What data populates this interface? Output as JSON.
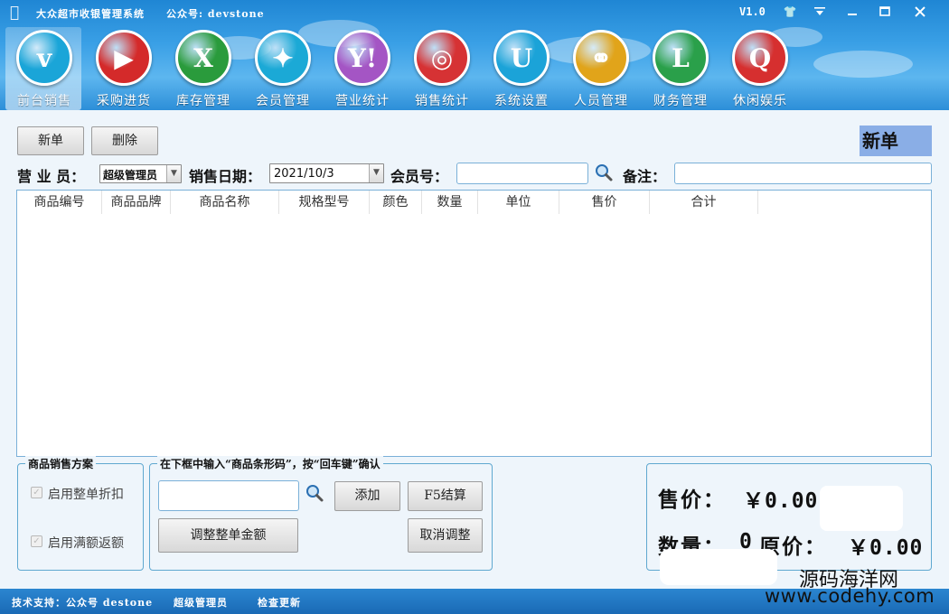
{
  "window": {
    "title": "大众超市收银管理系统",
    "account": "公众号: devstone",
    "version": "V1.0"
  },
  "nav": [
    {
      "label": "前台销售",
      "icon": "v-icon",
      "glyph": "v",
      "color": "#1aa5d8"
    },
    {
      "label": "采购进货",
      "icon": "youtube-icon",
      "glyph": "▶",
      "color": "#d42a2a"
    },
    {
      "label": "库存管理",
      "icon": "xing-icon",
      "glyph": "X",
      "color": "#2a9b3c"
    },
    {
      "label": "会员管理",
      "icon": "sparkle-icon",
      "glyph": "✦",
      "color": "#1ba9d6"
    },
    {
      "label": "营业统计",
      "icon": "yahoo-icon",
      "glyph": "Y!",
      "color": "#a455c4"
    },
    {
      "label": "销售统计",
      "icon": "weibo-icon",
      "glyph": "◎",
      "color": "#d63234"
    },
    {
      "label": "系统设置",
      "icon": "u-icon",
      "glyph": "U",
      "color": "#1ba3d8"
    },
    {
      "label": "人员管理",
      "icon": "chain-icon",
      "glyph": "⚭",
      "color": "#e1a41a"
    },
    {
      "label": "财务管理",
      "icon": "l-icon",
      "glyph": "L",
      "color": "#2aa04a"
    },
    {
      "label": "休闲娱乐",
      "icon": "q-icon",
      "glyph": "Q",
      "color": "#d62f2f"
    }
  ],
  "toolbar": {
    "new_label": "新单",
    "delete_label": "删除",
    "mode_label": "新单"
  },
  "form": {
    "salesperson_label": "营 业 员：",
    "salesperson_value": "超级管理员",
    "date_label": "销售日期：",
    "date_value": "2021/10/3",
    "member_label": "会员号：",
    "member_value": "",
    "remark_label": "备注：",
    "remark_value": ""
  },
  "table": {
    "columns": [
      "商品编号",
      "商品品牌",
      "商品名称",
      "规格型号",
      "颜色",
      "数量",
      "单位",
      "售价",
      "合计"
    ],
    "rows": []
  },
  "plan": {
    "title": "商品销售方案",
    "option1": "启用整单折扣",
    "option2": "启用满额返额"
  },
  "barcode": {
    "title": "在下框中输入“商品条形码”，按“回车键”确认",
    "input_value": "",
    "add_label": "添加",
    "checkout_label": "F5结算",
    "adjust_label": "调整整单金额",
    "cancel_adjust_label": "取消调整"
  },
  "totals": {
    "price_label": "售价：",
    "price_value": "￥0.00",
    "qty_label": "数量：",
    "qty_value": "0",
    "orig_label": "原价：",
    "orig_value": "￥0.00"
  },
  "status": {
    "support": "技术支持：公众号 destone",
    "user": "超级管理员",
    "update": "检查更新"
  },
  "watermark": {
    "line1": "源码海洋网",
    "line2": "www.codehy.com"
  }
}
